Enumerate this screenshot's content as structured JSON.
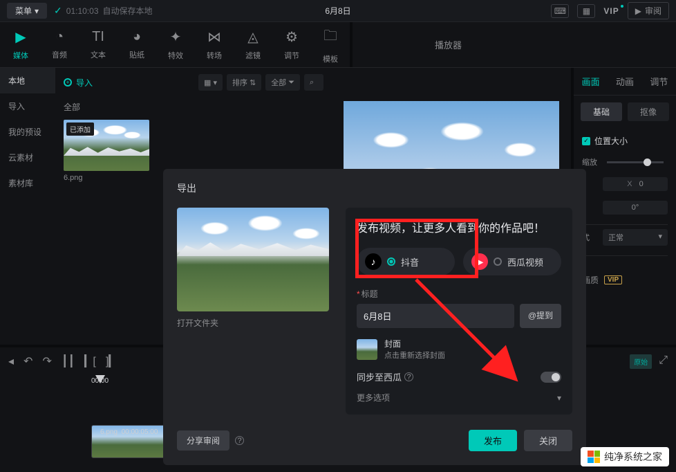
{
  "topbar": {
    "menu": "菜单",
    "autosave_time": "01:10:03",
    "autosave_text": "自动保存本地",
    "title": "6月8日",
    "vip": "VIP",
    "review": "审阅"
  },
  "toolbar": {
    "tabs": [
      "媒体",
      "音频",
      "文本",
      "贴纸",
      "特效",
      "转场",
      "滤镜",
      "调节",
      "模板"
    ],
    "player_label": "播放器"
  },
  "sidebar": {
    "items": [
      "本地",
      "导入",
      "我的预设",
      "云素材",
      "素材库"
    ]
  },
  "media": {
    "import": "导入",
    "sort": "排序",
    "filter_all": "全部",
    "all_label": "全部",
    "added_tag": "已添加",
    "thumb_name": "6.png"
  },
  "right_panel": {
    "tabs": [
      "画面",
      "动画",
      "调节"
    ],
    "subtabs": [
      "基础",
      "抠像"
    ],
    "section1": "位置大小",
    "zoom": "缩放",
    "x_label": "X",
    "x_value": "0",
    "rotation": "0°",
    "blend_label": "式",
    "blend_value": "正常",
    "quality_label": "画质",
    "quality_vip": "VIP"
  },
  "timeline": {
    "time_zero": "00:00",
    "clip_name": "6.png",
    "clip_dur": "00:00:05:00",
    "ratio": "原始"
  },
  "modal": {
    "title": "导出",
    "open_folder": "打开文件夹",
    "headline": "发布视频，让更多人看到你的作品吧！",
    "douyin": "抖音",
    "xigua": "西瓜视频",
    "field_title": "标题",
    "title_value": "6月8日",
    "mention": "@提到",
    "cover_t1": "封面",
    "cover_t2": "点击重新选择封面",
    "sync": "同步至西瓜",
    "more": "更多选项",
    "share_review": "分享审阅",
    "publish": "发布",
    "close": "关闭"
  },
  "watermark": "纯净系统之家"
}
